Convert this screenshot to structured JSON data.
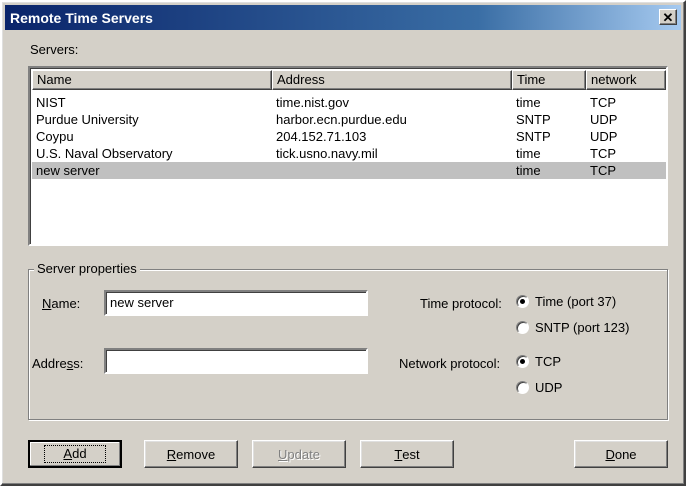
{
  "window": {
    "title": "Remote Time Servers",
    "close_glyph": "✕"
  },
  "servers_label": "Servers:",
  "columns": [
    "Name",
    "Address",
    "Time",
    "network"
  ],
  "rows": [
    [
      "NIST",
      "time.nist.gov",
      "time",
      "TCP"
    ],
    [
      "Purdue University",
      "harbor.ecn.purdue.edu",
      "SNTP",
      "UDP"
    ],
    [
      "Coypu",
      "204.152.71.103",
      "SNTP",
      "UDP"
    ],
    [
      "U.S. Naval Observatory",
      "tick.usno.navy.mil",
      "time",
      "TCP"
    ],
    [
      "new server",
      "",
      "time",
      "TCP"
    ]
  ],
  "selected_row": 4,
  "properties": {
    "group_label": "Server properties",
    "name_label": {
      "pre": "",
      "key": "N",
      "post": "ame:"
    },
    "name_value": "new server",
    "address_label": {
      "pre": "Addre",
      "key": "s",
      "post": "s:"
    },
    "address_value": "",
    "time_protocol_label": "Time protocol:",
    "time_options": [
      "Time (port 37)",
      "SNTP (port 123)"
    ],
    "time_selected": 0,
    "network_protocol_label": "Network protocol:",
    "network_options": [
      "TCP",
      "UDP"
    ],
    "network_selected": 0
  },
  "buttons": {
    "add": {
      "key": "A",
      "rest": "dd"
    },
    "remove": {
      "key": "R",
      "rest": "emove"
    },
    "update": {
      "key": "U",
      "rest": "pdate"
    },
    "test": {
      "key": "T",
      "rest": "est"
    },
    "done": {
      "key": "D",
      "rest": "one"
    }
  }
}
